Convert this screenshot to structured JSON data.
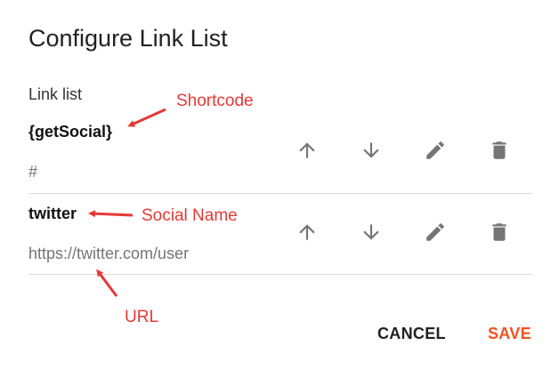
{
  "dialog": {
    "title": "Configure Link List",
    "section_label": "Link list",
    "cancel_label": "CANCEL",
    "save_label": "SAVE"
  },
  "items": [
    {
      "name": "{getSocial}",
      "url": "#"
    },
    {
      "name": "twitter",
      "url": "https://twitter.com/user"
    }
  ],
  "icons": [
    "arrow-up-icon",
    "arrow-down-icon",
    "pencil-icon",
    "trash-icon"
  ],
  "annotations": {
    "shortcode": "Shortcode",
    "social_name": "Social Name",
    "url": "URL"
  },
  "colors": {
    "accent": "#f4511e",
    "annotation": "#e53935",
    "icon": "#757575"
  }
}
